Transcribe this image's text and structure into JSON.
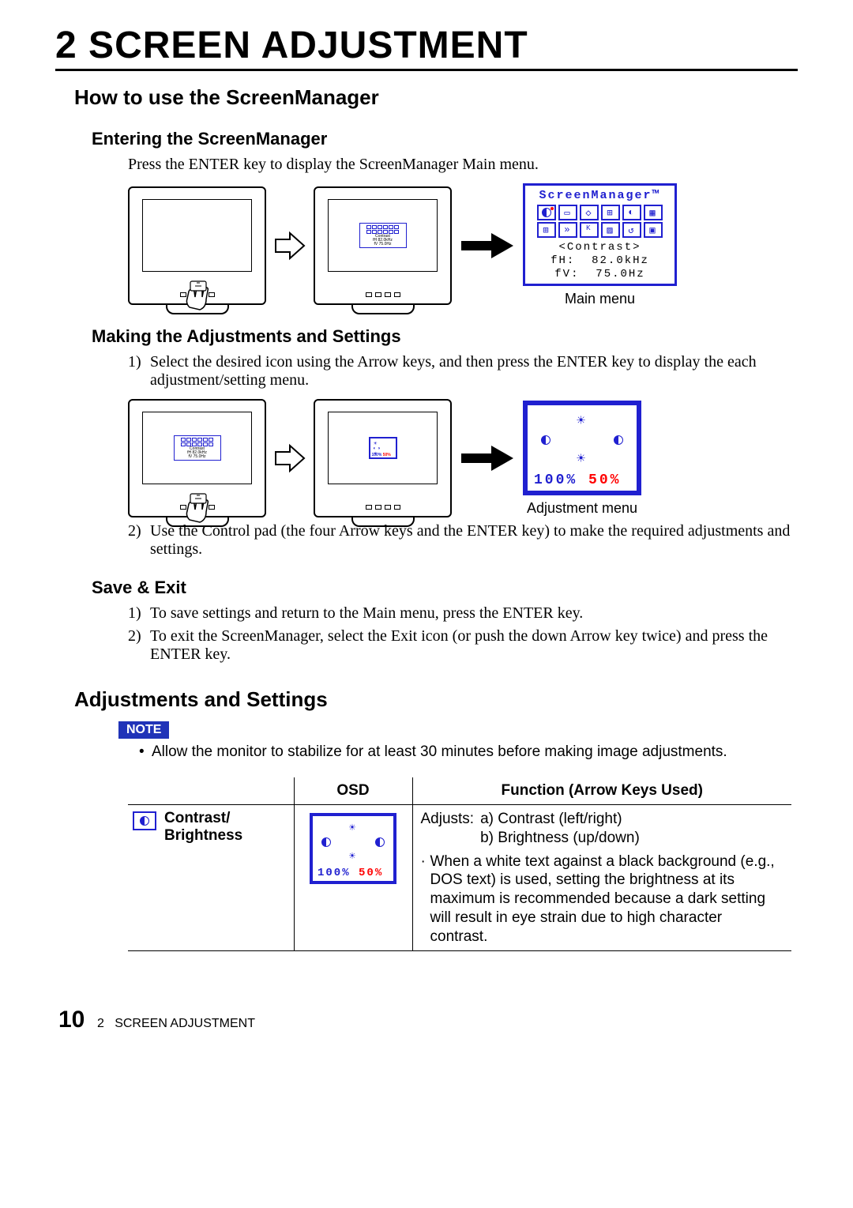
{
  "chapter": {
    "num": "2",
    "title": "SCREEN ADJUSTMENT"
  },
  "section1": {
    "title": "How to use the ScreenManager",
    "sub1": {
      "title": "Entering the ScreenManager",
      "p1": "Press the ENTER key to display the ScreenManager Main menu.",
      "fig_caption": "Main menu"
    },
    "sub2": {
      "title": "Making the Adjustments and Settings",
      "li1": "Select the desired icon using the Arrow keys, and then press the ENTER key to display the each adjustment/setting menu.",
      "fig_caption": "Adjustment menu",
      "li2": "Use the Control pad (the four Arrow keys and the ENTER key) to make the required adjustments and settings."
    },
    "sub3": {
      "title": "Save & Exit",
      "li1": "To save settings and return to the Main menu, press the ENTER key.",
      "li2": "To exit the ScreenManager, select the Exit icon (or push the down Arrow key twice) and press the ENTER key."
    }
  },
  "section2": {
    "title": "Adjustments and Settings",
    "note_label": "NOTE",
    "note_text": "Allow the monitor to stabilize for at least 30 minutes before making image adjustments.",
    "table": {
      "h_name": "",
      "h_osd": "OSD",
      "h_func": "Function (Arrow Keys Used)",
      "row1": {
        "name_line1": "Contrast/",
        "name_line2": "Brightness",
        "func_intro": "Adjusts:",
        "func_a": "a) Contrast (left/right)",
        "func_b": "b) Brightness (up/down)",
        "func_note": "When a white text against a black background (e.g., DOS text) is used, setting the brightness at its maximum is recommended because a dark setting will result in eye strain due to high character contrast."
      }
    }
  },
  "osd_main": {
    "title": "ScreenManager™",
    "info_label": "<Contrast>",
    "fh_label": "fH:",
    "fh_val": "82.0kHz",
    "fv_label": "fV:",
    "fv_val": "75.0Hz"
  },
  "osd_adjust": {
    "left_val": "100%",
    "right_val": "50%"
  },
  "footer": {
    "page": "10",
    "chap_num": "2",
    "chap_title": "SCREEN ADJUSTMENT"
  }
}
